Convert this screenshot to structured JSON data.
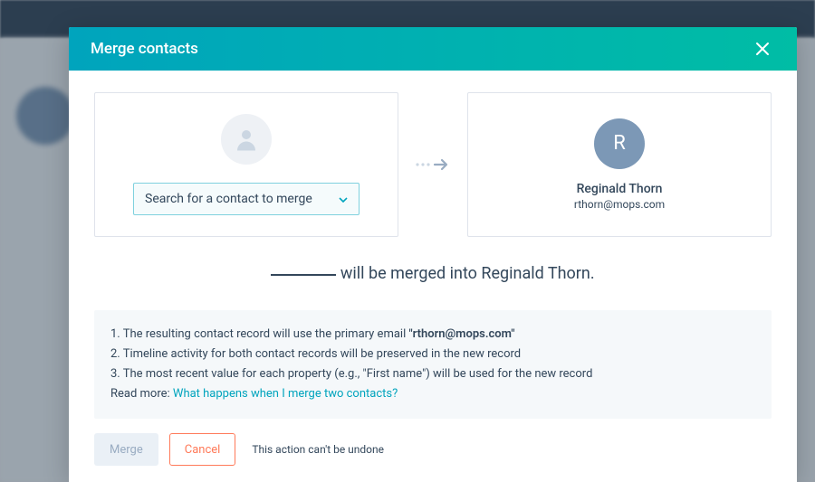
{
  "modal": {
    "title": "Merge contacts",
    "select_placeholder": "Search for a contact to merge",
    "target": {
      "initial": "R",
      "name": "Reginald Thorn",
      "email": "rthorn@mops.com"
    },
    "sentence_mid": " will be merged into ",
    "sentence_target": "Reginald Thorn",
    "sentence_end": ".",
    "info": {
      "line1_pre": "1. The resulting contact record will use the primary email ",
      "line1_bold": "\"rthorn@mops.com\"",
      "line2": "2. Timeline activity for both contact records will be preserved in the new record",
      "line3": "3. The most recent value for each property (e.g., \"First name\") will be used for the new record",
      "read_more_label": "Read more: ",
      "read_more_link": "What happens when I merge two contacts?"
    },
    "buttons": {
      "merge": "Merge",
      "cancel": "Cancel"
    },
    "footer_note": "This action can't be undone"
  }
}
